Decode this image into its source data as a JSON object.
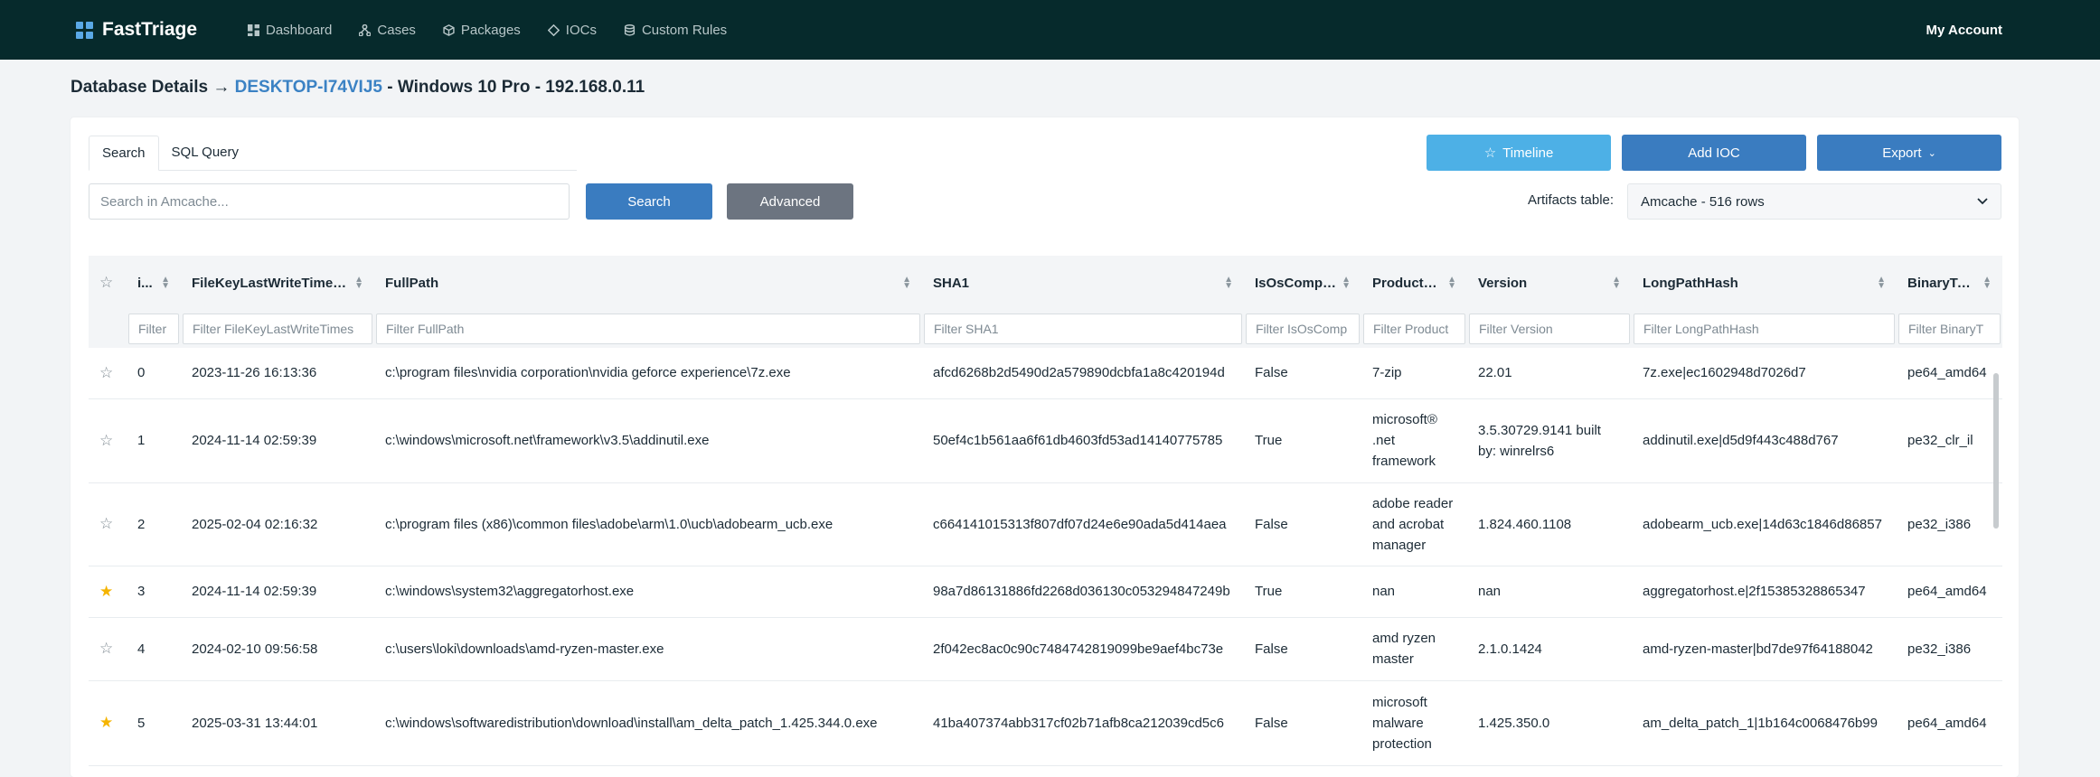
{
  "brand": "FastTriage",
  "nav": [
    {
      "label": "Dashboard",
      "icon": "dashboard-icon"
    },
    {
      "label": "Cases",
      "icon": "cases-icon"
    },
    {
      "label": "Packages",
      "icon": "packages-icon"
    },
    {
      "label": "IOCs",
      "icon": "iocs-icon"
    },
    {
      "label": "Custom Rules",
      "icon": "custom-rules-icon"
    }
  ],
  "account": "My Account",
  "title": {
    "prefix": "Database Details → ",
    "host": "DESKTOP-I74VIJ5",
    "suffix": " - Windows 10 Pro - 192.168.0.11"
  },
  "tabs": {
    "search": "Search",
    "sql": "SQL Query"
  },
  "buttons": {
    "timeline": "Timeline",
    "add_ioc": "Add IOC",
    "export": "Export",
    "search": "Search",
    "advanced": "Advanced"
  },
  "search": {
    "placeholder": "Search in Amcache..."
  },
  "artifacts": {
    "label": "Artifacts table:",
    "selected": "Amcache - 516 rows"
  },
  "table": {
    "headers": {
      "id": "i...",
      "key": "FileKeyLastWriteTimest...",
      "path": "FullPath",
      "sha1": "SHA1",
      "os": "IsOsCompo...",
      "product": "ProductN...",
      "version": "Version",
      "lph": "LongPathHash",
      "bt": "BinaryType"
    },
    "filters": {
      "id": "Filter",
      "key": "Filter FileKeyLastWriteTimes",
      "path": "Filter FullPath",
      "sha1": "Filter SHA1",
      "os": "Filter IsOsComp",
      "product": "Filter Product",
      "version": "Filter Version",
      "lph": "Filter LongPathHash",
      "bt": "Filter BinaryT"
    },
    "rows": [
      {
        "starred": false,
        "id": "0",
        "key": "2023-11-26 16:13:36",
        "path": "c:\\program files\\nvidia corporation\\nvidia geforce experience\\7z.exe",
        "sha1": "afcd6268b2d5490d2a579890dcbfa1a8c420194d",
        "os": "False",
        "product": "7-zip",
        "version": "22.01",
        "lph": "7z.exe|ec1602948d7026d7",
        "bt": "pe64_amd64"
      },
      {
        "starred": false,
        "id": "1",
        "key": "2024-11-14 02:59:39",
        "path": "c:\\windows\\microsoft.net\\framework\\v3.5\\addinutil.exe",
        "sha1": "50ef4c1b561aa6f61db4603fd53ad14140775785",
        "os": "True",
        "product": "microsoft® .net framework",
        "version": "3.5.30729.9141 built by: winrelrs6",
        "lph": "addinutil.exe|d5d9f443c488d767",
        "bt": "pe32_clr_il"
      },
      {
        "starred": false,
        "id": "2",
        "key": "2025-02-04 02:16:32",
        "path": "c:\\program files (x86)\\common files\\adobe\\arm\\1.0\\ucb\\adobearm_ucb.exe",
        "sha1": "c664141015313f807df07d24e6e90ada5d414aea",
        "os": "False",
        "product": "adobe reader and acrobat manager",
        "version": "1.824.460.1108",
        "lph": "adobearm_ucb.exe|14d63c1846d86857",
        "bt": "pe32_i386"
      },
      {
        "starred": true,
        "id": "3",
        "key": "2024-11-14 02:59:39",
        "path": "c:\\windows\\system32\\aggregatorhost.exe",
        "sha1": "98a7d86131886fd2268d036130c053294847249b",
        "os": "True",
        "product": "nan",
        "version": "nan",
        "lph": "aggregatorhost.e|2f15385328865347",
        "bt": "pe64_amd64"
      },
      {
        "starred": false,
        "id": "4",
        "key": "2024-02-10 09:56:58",
        "path": "c:\\users\\loki\\downloads\\amd-ryzen-master.exe",
        "sha1": "2f042ec8ac0c90c7484742819099be9aef4bc73e",
        "os": "False",
        "product": "amd ryzen master",
        "version": "2.1.0.1424",
        "lph": "amd-ryzen-master|bd7de97f64188042",
        "bt": "pe32_i386"
      },
      {
        "starred": true,
        "id": "5",
        "key": "2025-03-31 13:44:01",
        "path": "c:\\windows\\softwaredistribution\\download\\install\\am_delta_patch_1.425.344.0.exe",
        "sha1": "41ba407374abb317cf02b71afb8ca212039cd5c6",
        "os": "False",
        "product": "microsoft malware protection",
        "version": "1.425.350.0",
        "lph": "am_delta_patch_1|1b164c0068476b99",
        "bt": "pe64_amd64"
      }
    ]
  }
}
